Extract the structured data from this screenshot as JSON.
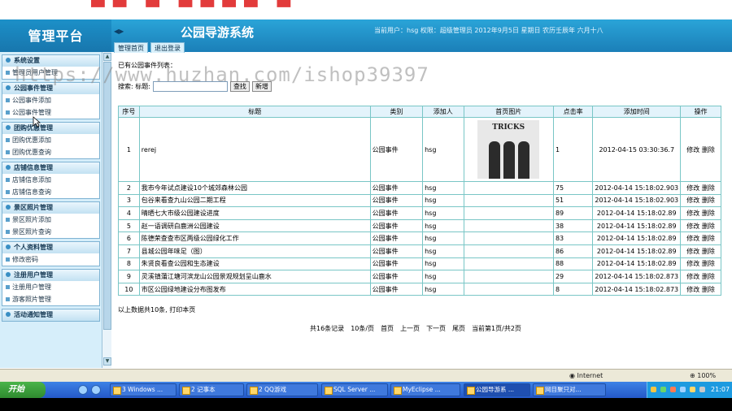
{
  "brand": "管理平台",
  "system_title": "公园导游系统",
  "header_info": "当前用户：hsg 权限：超级管理员         2012年9月5日  星期日  农历壬辰年  六月十八",
  "tabs": [
    "管理首页",
    "退出登录"
  ],
  "sidebar": [
    {
      "title": "系统设置",
      "items": [
        "管理员用户管理"
      ]
    },
    {
      "title": "公园事件管理",
      "items": [
        "公园事件添加",
        "公园事件管理"
      ]
    },
    {
      "title": "团购优惠管理",
      "items": [
        "团购优惠添加",
        "团购优惠查询"
      ]
    },
    {
      "title": "店铺信息管理",
      "items": [
        "店铺信息添加",
        "店铺信息查询"
      ]
    },
    {
      "title": "景区照片管理",
      "items": [
        "景区照片添加",
        "景区照片查询"
      ]
    },
    {
      "title": "个人资料管理",
      "items": [
        "修改密码"
      ]
    },
    {
      "title": "注册用户管理",
      "items": [
        "注册用户管理",
        "游客照片管理"
      ]
    },
    {
      "title": "活动通知管理",
      "items": []
    }
  ],
  "main": {
    "list_label": "已有公园事件列表：",
    "search_label": "搜索: 标题:",
    "search_value": "",
    "search_button": "查找",
    "add_button": "新增",
    "columns": [
      "序号",
      "标题",
      "类别",
      "添加人",
      "首页图片",
      "点击率",
      "添加时间",
      "操作"
    ],
    "rows": [
      {
        "no": "1",
        "title": "rerej",
        "category": "公园事件",
        "by": "hsg",
        "image": "TRICKS",
        "clicks": "1",
        "time": "2012-04-15 03:30:36.7"
      },
      {
        "no": "2",
        "title": "我市今年试点建设10个城郊森林公园",
        "category": "公园事件",
        "by": "hsg",
        "image": "",
        "clicks": "75",
        "time": "2012-04-14 15:18:02.903"
      },
      {
        "no": "3",
        "title": "包谷来看查九山公园二期工程",
        "category": "公园事件",
        "by": "hsg",
        "image": "",
        "clicks": "51",
        "time": "2012-04-14 15:18:02.903"
      },
      {
        "no": "4",
        "title": "晴晒七大市级公园建设进度",
        "category": "公园事件",
        "by": "hsg",
        "image": "",
        "clicks": "89",
        "time": "2012-04-14 15:18:02.89"
      },
      {
        "no": "5",
        "title": "赵一语调研白鹿洲公园建设",
        "category": "公园事件",
        "by": "hsg",
        "image": "",
        "clicks": "38",
        "time": "2012-04-14 15:18:02.89"
      },
      {
        "no": "6",
        "title": "陈德荣查查市区两级公园绿化工作",
        "category": "公园事件",
        "by": "hsg",
        "image": "",
        "clicks": "83",
        "time": "2012-04-14 15:18:02.89"
      },
      {
        "no": "7",
        "title": "县城公园年味足（图）",
        "category": "公园事件",
        "by": "hsg",
        "image": "",
        "clicks": "86",
        "time": "2012-04-14 15:18:02.89"
      },
      {
        "no": "8",
        "title": "朱贤良看查公园和生态建设",
        "category": "公园事件",
        "by": "hsg",
        "image": "",
        "clicks": "88",
        "time": "2012-04-14 15:18:02.89"
      },
      {
        "no": "9",
        "title": "灵溪镇蒲江塘河滨龙山公园景观规划呈山鹿水",
        "category": "公园事件",
        "by": "hsg",
        "image": "",
        "clicks": "29",
        "time": "2012-04-14 15:18:02.873"
      },
      {
        "no": "10",
        "title": "市区公园绿地建设分布图发布",
        "category": "公园事件",
        "by": "hsg",
        "image": "",
        "clicks": "8",
        "time": "2012-04-14 15:18:02.873"
      }
    ],
    "edit_label": "修改",
    "delete_label": "删除",
    "summary": "以上数据共10条, 打印本页",
    "pager": {
      "total": "共16条记录",
      "per_page": "10条/页",
      "first": "首页",
      "prev": "上一页",
      "next": "下一页",
      "last": "尾页",
      "current": "当前第1页/共2页"
    }
  },
  "status_bar": {
    "zone": "Internet",
    "zoom": "100%"
  },
  "taskbar": {
    "start": "开始",
    "tasks": [
      "3 Windows ...",
      "2 记事本",
      "2 QQ游戏",
      "SQL Server ...",
      "MyEclipse ...",
      "公园导游系 ...",
      "网目聚只对..."
    ],
    "clock": "21:07"
  },
  "watermark": "https://www.huzhan.com/ishop39397",
  "colors": {
    "header": "#1b7fb8",
    "grid_border": "#79c6c6",
    "sidebar_bg": "#d6eefa"
  }
}
